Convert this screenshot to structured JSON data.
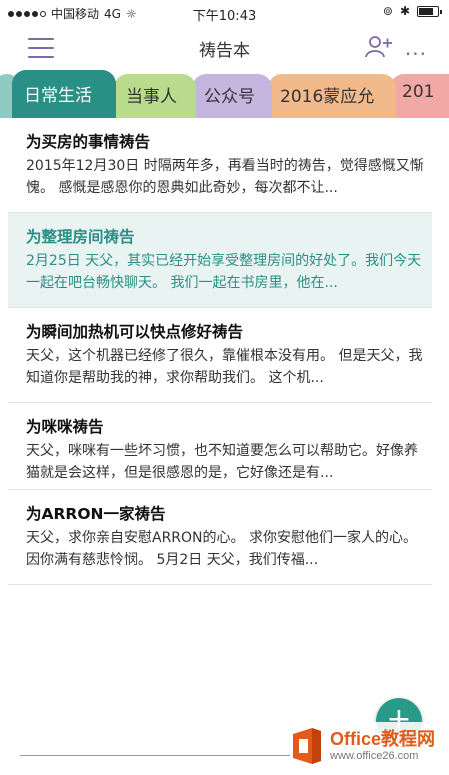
{
  "status_bar": {
    "carrier": "中国移动",
    "network": "4G",
    "time": "下午10:43"
  },
  "header": {
    "title": "祷告本",
    "menu_icon": "hamburger-menu-icon",
    "add_user_icon": "add-user-icon",
    "more_label": "...",
    "accent_color": "#7e6aa6"
  },
  "tabs": [
    {
      "label": "日常生活",
      "color": "#2a8f86",
      "active": true
    },
    {
      "label": "当事人",
      "color": "#b9dc8c"
    },
    {
      "label": "公众号",
      "color": "#c5b6e0"
    },
    {
      "label": "2016蒙应允",
      "color": "#f2ba8a"
    },
    {
      "label": "201",
      "color": "#f0a9a4"
    }
  ],
  "notes": [
    {
      "title": "为买房的事情祷告",
      "preview": "2015年12月30日 时隔两年多，再看当时的祷告，觉得感慨又惭愧。 感慨是感恩你的恩典如此奇妙，每次都不让..."
    },
    {
      "title": "为整理房间祷告",
      "preview": "2月25日 天父，其实已经开始享受整理房间的好处了。我们今天一起在吧台畅快聊天。 我们一起在书房里，他在...",
      "selected": true
    },
    {
      "title": "为瞬间加热机可以快点修好祷告",
      "preview": "天父，这个机器已经修了很久，靠催根本没有用。 但是天父，我知道你是帮助我的神，求你帮助我们。 这个机..."
    },
    {
      "title": "为咪咪祷告",
      "preview": "天父，咪咪有一些坏习惯，也不知道要怎么可以帮助它。好像养猫就是会这样，但是很感恩的是，它好像还是有..."
    },
    {
      "title": "为ARRON一家祷告",
      "preview": "天父，求你亲自安慰ARRON的心。 求你安慰他们一家人的心。 因你满有慈悲怜悯。 5月2日 天父，我们传福..."
    }
  ],
  "fab": {
    "label": "+",
    "color": "#2a9a88"
  },
  "watermark": {
    "name": "Office教程网",
    "url": "www.office26.com"
  }
}
